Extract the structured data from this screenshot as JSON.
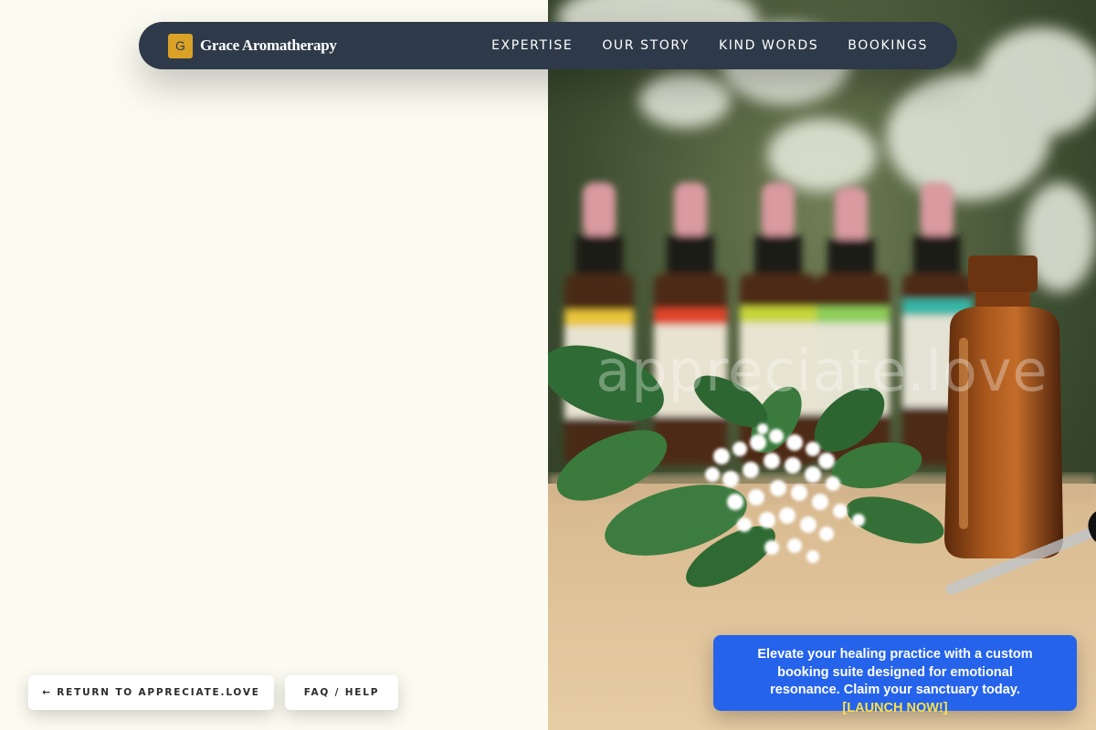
{
  "header": {
    "logo_letter": "G",
    "brand": "Grace Aromatherapy",
    "nav": [
      {
        "label": "EXPERTISE"
      },
      {
        "label": "OUR STORY"
      },
      {
        "label": "KIND WORDS"
      },
      {
        "label": "BOOKINGS"
      }
    ]
  },
  "hero": {
    "watermark": "appreciate.love"
  },
  "footer_buttons": {
    "return_label": "← RETURN TO APPRECIATE.LOVE",
    "faq_label": "FAQ / HELP"
  },
  "promo": {
    "text": "Elevate your healing practice with a custom booking suite designed for emotional resonance. Claim your sanctuary today.",
    "cta": "[LAUNCH NOW!]"
  },
  "colors": {
    "nav_bg": "#2e3a49",
    "logo_accent": "#d9a227",
    "promo_bg": "#2563eb",
    "promo_cta": "#fde047",
    "page_bg": "#fcfbf1"
  }
}
